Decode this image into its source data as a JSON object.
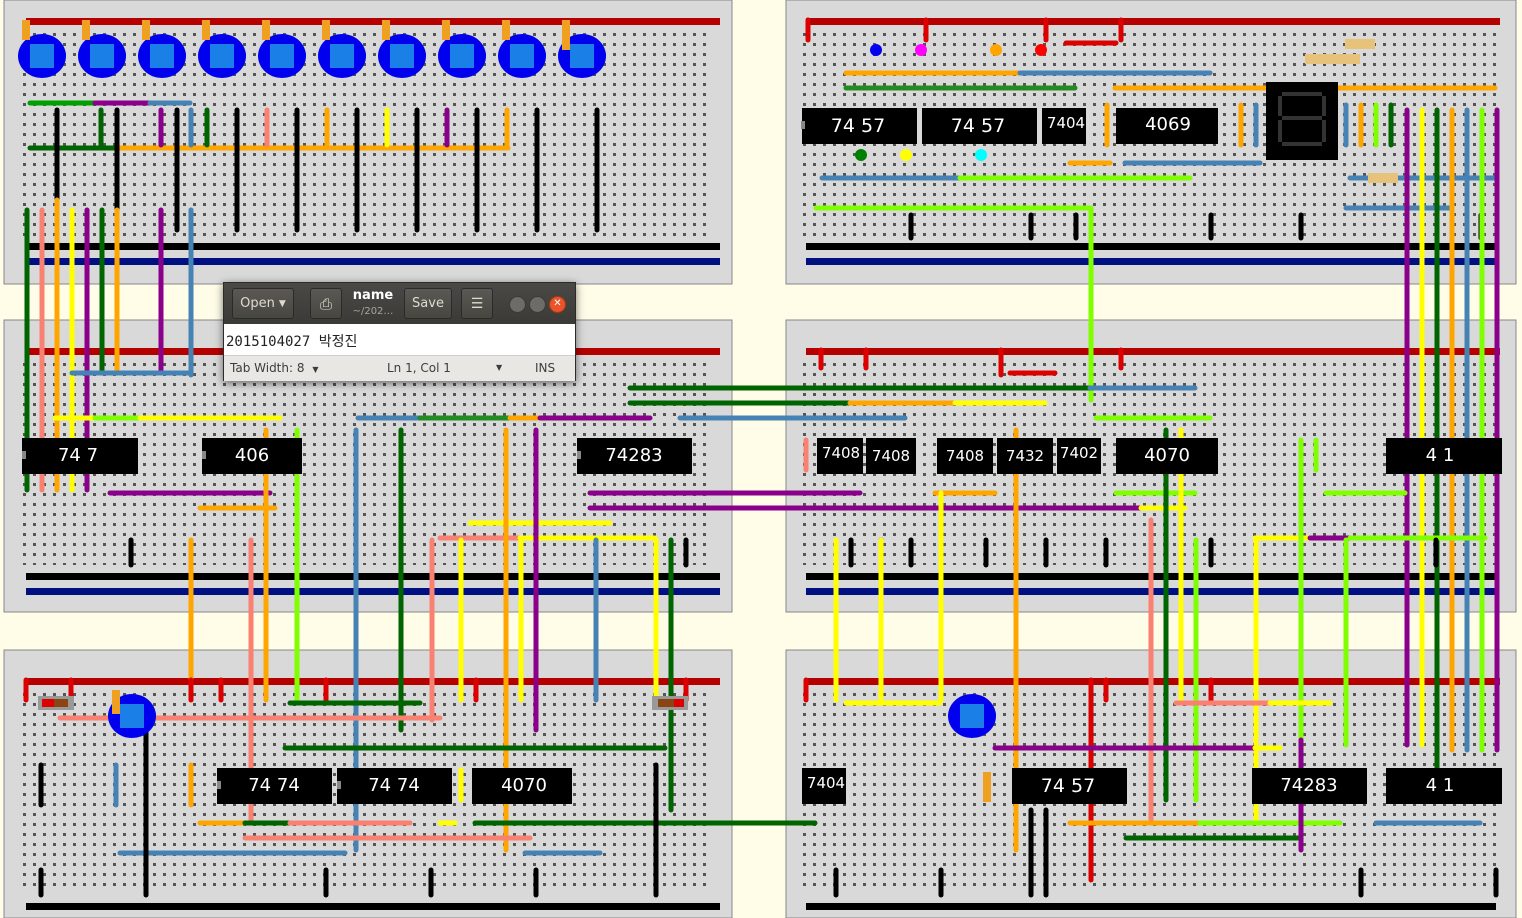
{
  "editor": {
    "open_label": "Open",
    "save_label": "Save",
    "title": "name",
    "subtitle": "~/202…",
    "content": "2015104027 박정진",
    "tab_width": "Tab Width: 8",
    "cursor_pos": "Ln 1, Col 1",
    "insert_mode": "INS"
  },
  "chips": {
    "c1": "74 57",
    "c2": "74 57",
    "c3": "7404",
    "c4": "4069",
    "c5": "74 7",
    "c6": "406",
    "c7": "74283",
    "c8": "7408",
    "c9": "7408",
    "c10": "7408",
    "c11": "7432",
    "c12": "7402",
    "c13": "4070",
    "c14": "4 1",
    "c15": "74 74",
    "c16": "74 74",
    "c17": "4070",
    "c18": "7404",
    "c19": "74 57",
    "c20": "74283",
    "c21": "4 1"
  },
  "colors": {
    "board_bg": "#d9d9d9",
    "rail_red": "#b50000",
    "rail_black": "#000000",
    "rail_blue": "#001080",
    "gap": "#fffde8",
    "led": "#0000ee",
    "led_inner": "#1a80e8"
  }
}
